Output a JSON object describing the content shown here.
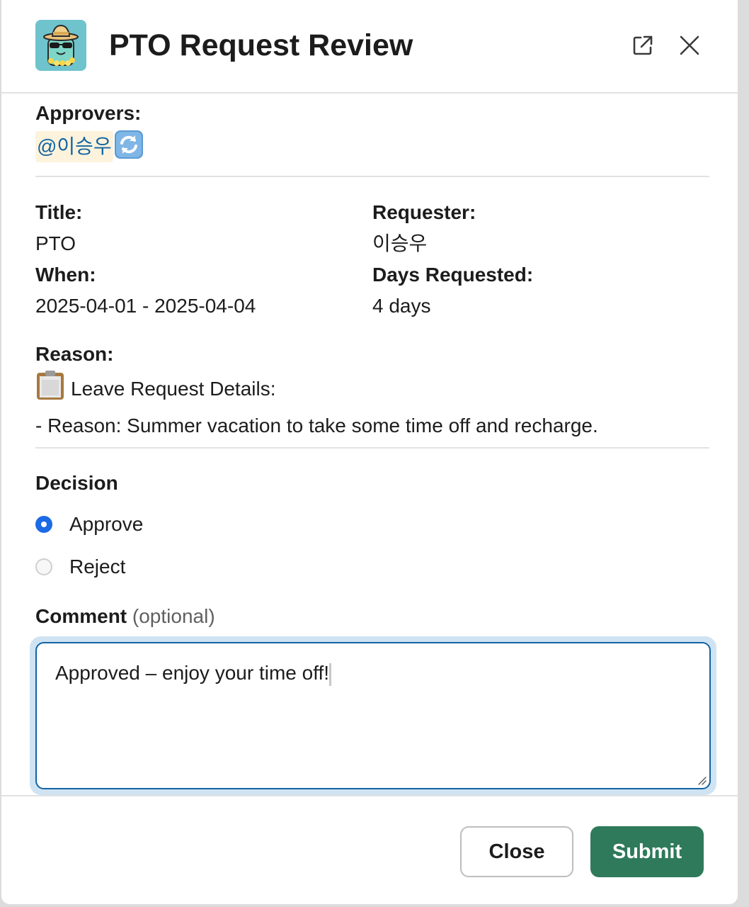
{
  "header": {
    "title": "PTO Request Review",
    "app_icon": "beach-sunglasses-avatar-icon",
    "open_icon": "external-link-icon",
    "close_icon": "close-icon"
  },
  "approvers": {
    "label": "Approvers:",
    "mention": "@이승우",
    "status_emoji": "arrows-counterclockwise-icon"
  },
  "details": {
    "title_label": "Title:",
    "title_value": "PTO",
    "when_label": "When:",
    "when_value": "2025-04-01 - 2025-04-04",
    "requester_label": "Requester:",
    "requester_value": "이승우",
    "days_label": "Days Requested:",
    "days_value": "4 days"
  },
  "reason": {
    "label": "Reason:",
    "line1_emoji": "clipboard-icon",
    "line1": "Leave Request Details:",
    "line2": "- Reason: Summer vacation to take some time off and recharge."
  },
  "decision": {
    "label": "Decision",
    "options": [
      {
        "label": "Approve",
        "checked": true
      },
      {
        "label": "Reject",
        "checked": false
      }
    ]
  },
  "comment": {
    "label": "Comment",
    "optional": "(optional)",
    "value": "Approved – enjoy your time off!"
  },
  "footer": {
    "close_label": "Close",
    "submit_label": "Submit"
  },
  "colors": {
    "submit": "#2e7a5a",
    "radio_checked": "#1d6ae5",
    "focus_ring": "#1264a3",
    "mention_bg": "#fdf3dc",
    "mention_text": "#1264a3"
  }
}
